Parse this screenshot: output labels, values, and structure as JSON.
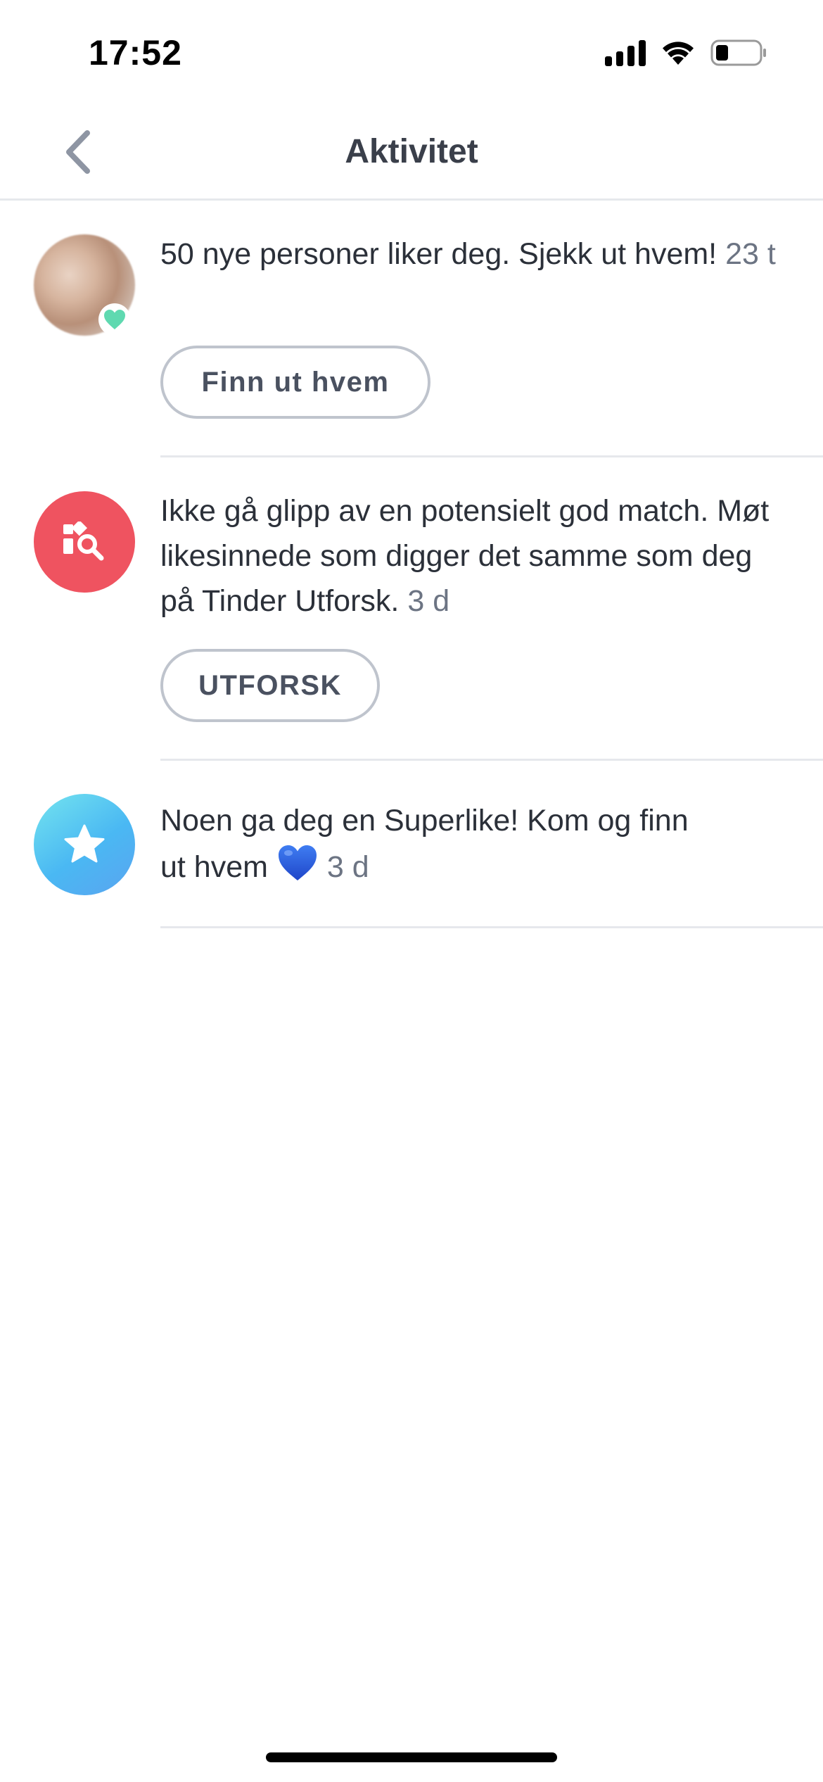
{
  "status_bar": {
    "time": "17:52",
    "icons": [
      "cellular-signal-icon",
      "wifi-icon",
      "battery-icon"
    ],
    "battery_level": 0.25
  },
  "header": {
    "back_icon": "chevron-left-icon",
    "title": "Aktivitet"
  },
  "colors": {
    "accent_red": "#ef5360",
    "accent_blue": "#4ab8f3",
    "heart_green": "#5fd9b0",
    "timestamp_gray": "#6c7483",
    "divider": "#e6e8ec"
  },
  "activities": [
    {
      "icon": "blurred-profile-avatar",
      "badge_icon": "green-heart-icon",
      "text": "50 nye personer liker deg. Sjekk ut hvem!",
      "time": "23 t",
      "button_label": "Finn ut hvem"
    },
    {
      "icon": "explore-search-icon",
      "text": "Ikke gå glipp av en potensielt god match. Møt likesinnede som digger det samme som deg på Tinder Utforsk.",
      "time": "3 d",
      "button_label": "UTFORSK"
    },
    {
      "icon": "star-icon",
      "text": "Noen ga deg en Superlike! Kom og finn ut hvem",
      "emoji_icon": "blue-heart-emoji-icon",
      "time": "3 d"
    }
  ]
}
